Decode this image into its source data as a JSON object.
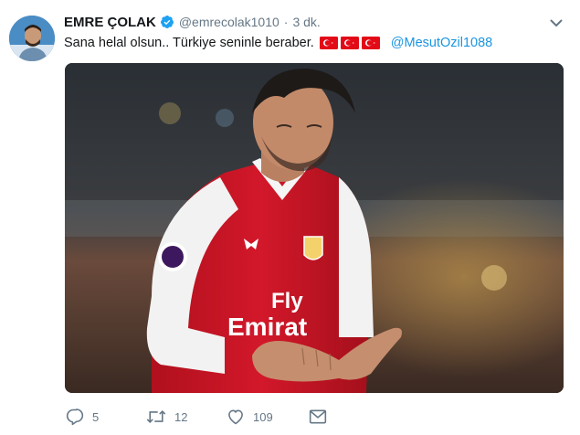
{
  "tweet": {
    "display_name": "EMRE ÇOLAK",
    "handle": "@emrecolak1010",
    "separator": "·",
    "time": "3 dk.",
    "text": "Sana helal olsun..  Türkiye seninle beraber.",
    "mention": "@MesutOzil1088",
    "photo_text": {
      "sponsor_line1": "Fly",
      "sponsor_line2": "Emirat"
    },
    "actions": {
      "reply_count": "5",
      "retweet_count": "12",
      "like_count": "109"
    },
    "colors": {
      "name": "#14171a",
      "meta": "#657786",
      "link": "#1b95e0",
      "verified": "#1da1f2",
      "flag": "#e30a17"
    },
    "icons": [
      "verified-badge-icon",
      "chevron-down-icon",
      "turkish-flag-icon",
      "reply-icon",
      "retweet-icon",
      "like-icon",
      "direct-message-icon"
    ]
  }
}
